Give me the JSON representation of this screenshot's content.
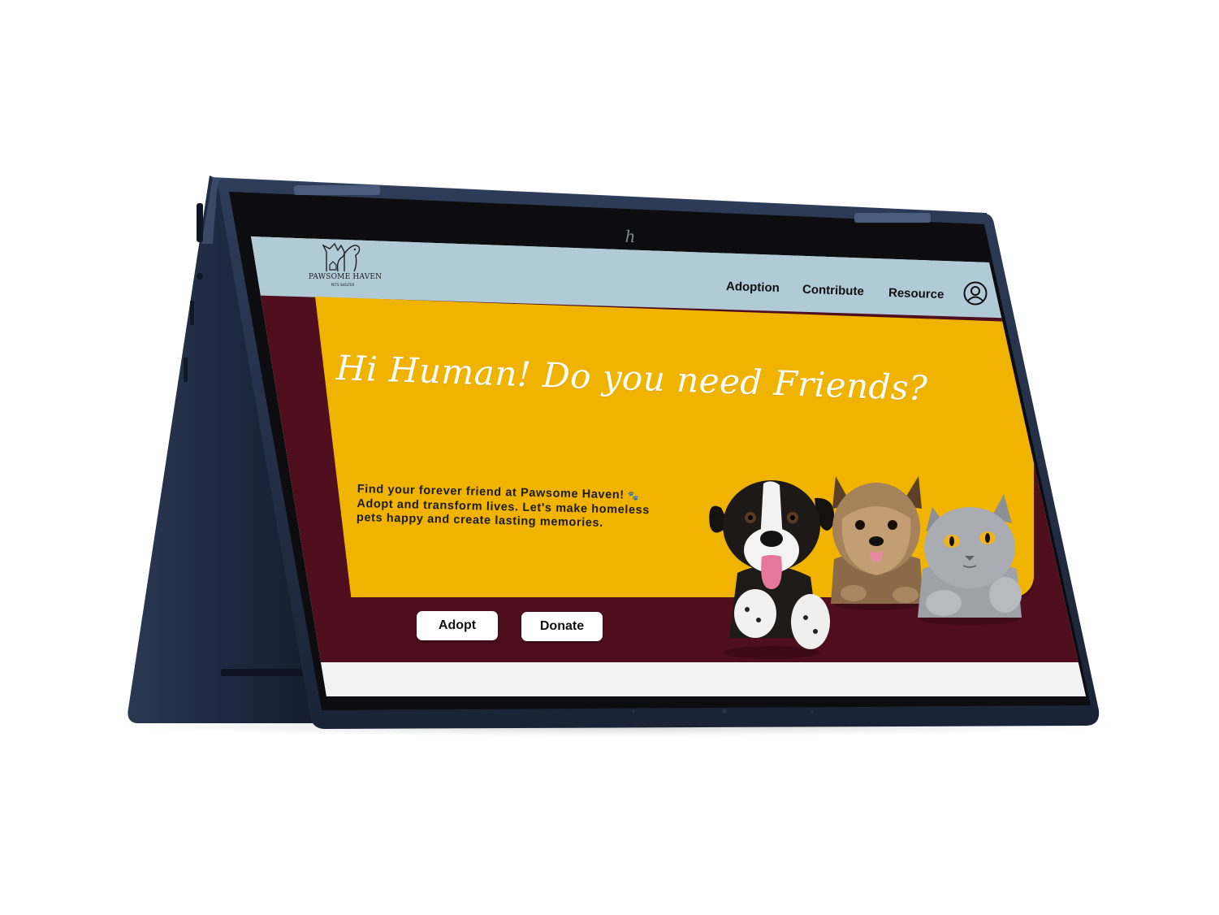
{
  "brand": {
    "name": "PAWSOME HAVEN",
    "tagline": "PETS SHELTER"
  },
  "nav": {
    "items": [
      {
        "label": "Adoption"
      },
      {
        "label": "Contribute"
      },
      {
        "label": "Resource"
      }
    ],
    "profile_icon": "user-circle-icon"
  },
  "hero": {
    "title": "Hi Human! Do you need Friends?",
    "copy": "Find your forever friend at Pawsome Haven! 🐾 Adopt and transform lives. Let's make homeless pets happy and create lasting memories.",
    "copy_line1": "Find your forever friend at Pawsome Haven!",
    "copy_line2": "Adopt and transform lives. Let's make homeless",
    "copy_line3": "pets happy and create lasting memories.",
    "paw_icon": "paw-prints-icon"
  },
  "actions": {
    "adopt_label": "Adopt",
    "donate_label": "Donate"
  },
  "pets": [
    {
      "name": "black-white-puppy"
    },
    {
      "name": "yorkshire-terrier"
    },
    {
      "name": "grey-british-shorthair-cat"
    }
  ],
  "colors": {
    "header_bg": "#b0cad6",
    "band_bg": "#4f0e1e",
    "card_bg": "#f0b300",
    "device_body": "#1f2b42"
  }
}
